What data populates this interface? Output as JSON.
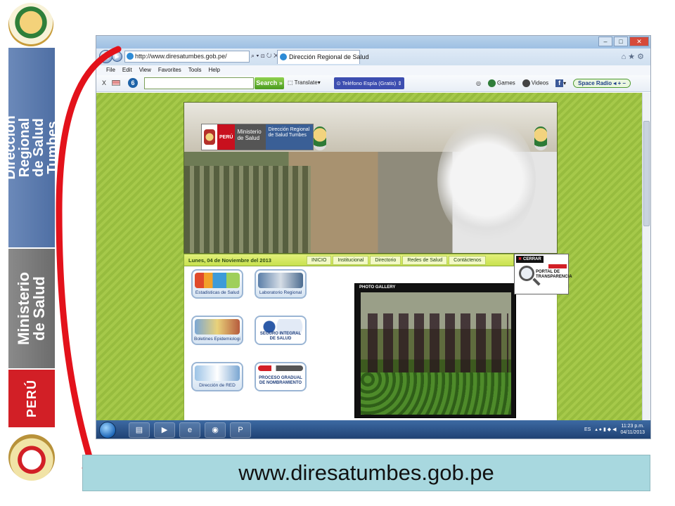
{
  "branding": {
    "dir_bar": "Dirección Regional de Salud Tumbes",
    "dir_lines": [
      "Dirección",
      "Regional",
      "de Salud",
      "Tumbes"
    ],
    "min_lines": [
      "Ministerio",
      "de Salud"
    ],
    "peru": "PERÚ"
  },
  "browser": {
    "address_url": "http://www.diresatumbes.gob.pe/",
    "tab_title": "Dirección Regional de Salud",
    "menu": [
      "File",
      "Edit",
      "View",
      "Favorites",
      "Tools",
      "Help"
    ],
    "toolbar": {
      "close": "X",
      "search_label": "Search »",
      "translate": "Translate",
      "telefono": "⊙ Teléfono Espía (Gratis) ⇕",
      "games": "Games",
      "videos": "Videos",
      "space_radio": "Space Radio"
    }
  },
  "site": {
    "ministry": {
      "peru": "PERÚ",
      "ministerio": "Ministerio de Salud",
      "direccion": "Dirección Regional de Salud Tumbes"
    },
    "date": "Lunes, 04 de Noviembre del 2013",
    "nav": [
      "INICIO",
      "Institucional",
      "Directorio",
      "Redes de Salud",
      "Contáctenos"
    ],
    "tiles": [
      {
        "label": "Estadisticas de Salud"
      },
      {
        "label": "Laboratorio Regional"
      },
      {
        "label": "Boletines Epidemiologicos"
      },
      {
        "label": "SEGURO INTEGRAL DE SALUD"
      },
      {
        "label": "Dirección de RED"
      },
      {
        "label": "PROCESO GRADUAL DE NOMBRAMIENTO"
      }
    ],
    "gallery_label": "PHOTO GALLERY",
    "transparency": {
      "close": "CERRAR",
      "label": "PORTAL DE TRANSPARENCIA"
    }
  },
  "taskbar": {
    "lang": "ES",
    "time": "11:23 p.m.",
    "date": "04/11/2013"
  },
  "caption": {
    "url": "www.diresatumbes.gob.pe"
  },
  "colors": {
    "arrow": "#e3121b",
    "dir_bar": "#5b7aae",
    "min_bar": "#7a7a7a",
    "peru_bar": "#d21f26",
    "caption_bg": "#a8d8df"
  }
}
